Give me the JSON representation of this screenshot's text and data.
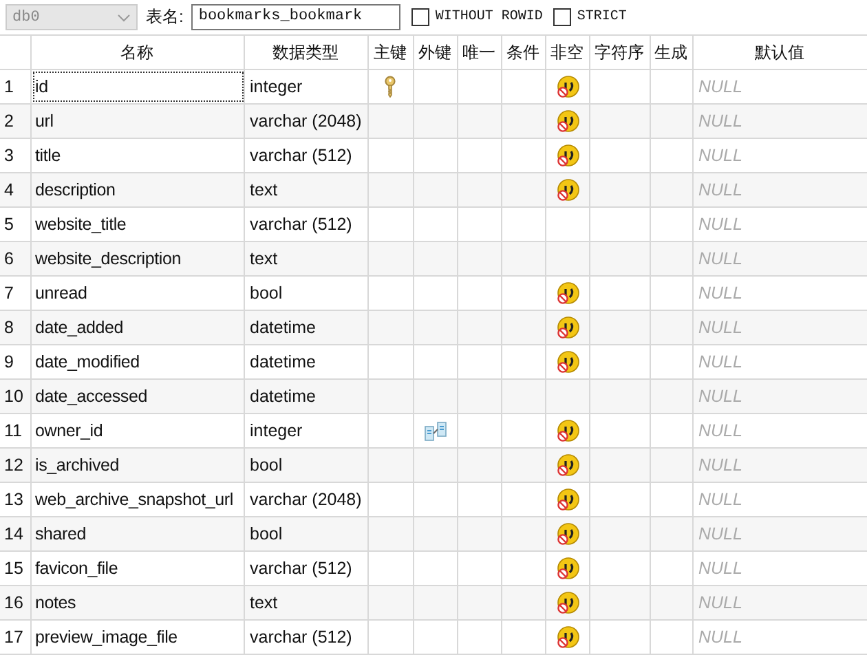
{
  "toolbar": {
    "schema": {
      "value": "db0",
      "disabled": true
    },
    "table_name_label": "表名:",
    "table_name": "bookmarks_bookmark",
    "options": [
      {
        "label": "WITHOUT ROWID",
        "checked": false
      },
      {
        "label": "STRICT",
        "checked": false
      }
    ]
  },
  "columns": [
    "名称",
    "数据类型",
    "主键",
    "外键",
    "唯一",
    "条件",
    "非空",
    "字符序",
    "生成",
    "默认值"
  ],
  "rows": [
    {
      "num": "1",
      "name": "id",
      "type": "integer",
      "primary_key": true,
      "foreign_key": false,
      "not_null": true,
      "default": "NULL",
      "focused": true
    },
    {
      "num": "2",
      "name": "url",
      "type": "varchar (2048)",
      "primary_key": false,
      "foreign_key": false,
      "not_null": true,
      "default": "NULL",
      "focused": false
    },
    {
      "num": "3",
      "name": "title",
      "type": "varchar (512)",
      "primary_key": false,
      "foreign_key": false,
      "not_null": true,
      "default": "NULL",
      "focused": false
    },
    {
      "num": "4",
      "name": "description",
      "type": "text",
      "primary_key": false,
      "foreign_key": false,
      "not_null": true,
      "default": "NULL",
      "focused": false
    },
    {
      "num": "5",
      "name": "website_title",
      "type": "varchar (512)",
      "primary_key": false,
      "foreign_key": false,
      "not_null": false,
      "default": "NULL",
      "focused": false
    },
    {
      "num": "6",
      "name": "website_description",
      "type": "text",
      "primary_key": false,
      "foreign_key": false,
      "not_null": false,
      "default": "NULL",
      "focused": false
    },
    {
      "num": "7",
      "name": "unread",
      "type": "bool",
      "primary_key": false,
      "foreign_key": false,
      "not_null": true,
      "default": "NULL",
      "focused": false
    },
    {
      "num": "8",
      "name": "date_added",
      "type": "datetime",
      "primary_key": false,
      "foreign_key": false,
      "not_null": true,
      "default": "NULL",
      "focused": false
    },
    {
      "num": "9",
      "name": "date_modified",
      "type": "datetime",
      "primary_key": false,
      "foreign_key": false,
      "not_null": true,
      "default": "NULL",
      "focused": false
    },
    {
      "num": "10",
      "name": "date_accessed",
      "type": "datetime",
      "primary_key": false,
      "foreign_key": false,
      "not_null": false,
      "default": "NULL",
      "focused": false
    },
    {
      "num": "11",
      "name": "owner_id",
      "type": "integer",
      "primary_key": false,
      "foreign_key": true,
      "not_null": true,
      "default": "NULL",
      "focused": false
    },
    {
      "num": "12",
      "name": "is_archived",
      "type": "bool",
      "primary_key": false,
      "foreign_key": false,
      "not_null": true,
      "default": "NULL",
      "focused": false
    },
    {
      "num": "13",
      "name": "web_archive_snapshot_url",
      "type": "varchar (2048)",
      "primary_key": false,
      "foreign_key": false,
      "not_null": true,
      "default": "NULL",
      "focused": false
    },
    {
      "num": "14",
      "name": "shared",
      "type": "bool",
      "primary_key": false,
      "foreign_key": false,
      "not_null": true,
      "default": "NULL",
      "focused": false
    },
    {
      "num": "15",
      "name": "favicon_file",
      "type": "varchar (512)",
      "primary_key": false,
      "foreign_key": false,
      "not_null": true,
      "default": "NULL",
      "focused": false
    },
    {
      "num": "16",
      "name": "notes",
      "type": "text",
      "primary_key": false,
      "foreign_key": false,
      "not_null": true,
      "default": "NULL",
      "focused": false
    },
    {
      "num": "17",
      "name": "preview_image_file",
      "type": "varchar (512)",
      "primary_key": false,
      "foreign_key": false,
      "not_null": true,
      "default": "NULL",
      "focused": false
    }
  ]
}
